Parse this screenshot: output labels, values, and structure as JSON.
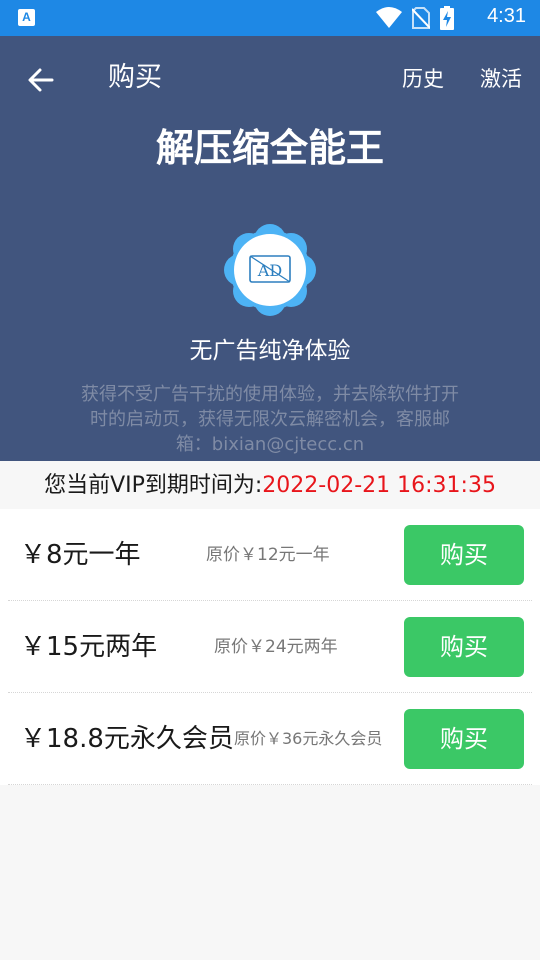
{
  "status_bar": {
    "app_badge": "A",
    "time": "4:31",
    "icons": [
      "wifi-icon",
      "no-sim-icon",
      "battery-charging-icon"
    ]
  },
  "header": {
    "back_icon": "arrow-left-icon",
    "title": "购买",
    "history": "历史",
    "activate": "激活"
  },
  "hero": {
    "app_name": "解压缩全能王",
    "badge_text": "AD",
    "feature_title": "无广告纯净体验",
    "feature_desc": "获得不受广告干扰的使用体验，并去除软件打开时的启动页，获得无限次云解密机会，客服邮箱：bixian@cjtecc.cn"
  },
  "vip": {
    "label": "您当前VIP到期时间为:",
    "expiry": "2022-02-21 16:31:35"
  },
  "plans": [
    {
      "price": "￥8元一年",
      "original": "原价￥12元一年",
      "button": "购买"
    },
    {
      "price": "￥15元两年",
      "original": "原价￥24元两年",
      "button": "购买"
    },
    {
      "price": "￥18.8元永久会员",
      "original": "原价￥36元永久会员",
      "button": "购买"
    }
  ],
  "colors": {
    "status_bar": "#1e88e5",
    "hero_bg": "#41557e",
    "badge_blue": "#4db3f5",
    "buy_green": "#3bc866",
    "expiry_red": "#e8151b"
  }
}
